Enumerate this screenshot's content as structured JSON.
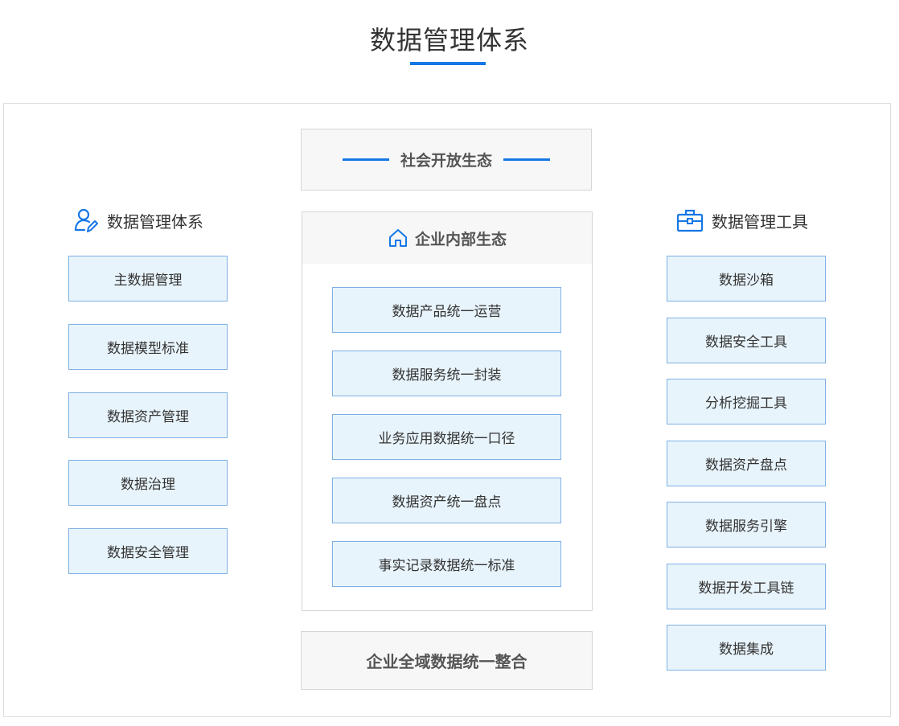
{
  "page_title": "数据管理体系",
  "colors": {
    "accent": "#1677e6",
    "box_fill": "#e8f4fc",
    "box_border": "#7fb0e4",
    "panel_fill": "#f7f7f7"
  },
  "left_column": {
    "title": "数据管理体系",
    "icon": "user-edit-icon",
    "items": [
      "主数据管理",
      "数据模型标准",
      "数据资产管理",
      "数据治理",
      "数据安全管理"
    ]
  },
  "center_column": {
    "top_panel": "社会开放生态",
    "middle_panel": {
      "title": "企业内部生态",
      "icon": "home-icon",
      "items": [
        "数据产品统一运营",
        "数据服务统一封装",
        "业务应用数据统一口径",
        "数据资产统一盘点",
        "事实记录数据统一标准"
      ]
    },
    "bottom_panel": "企业全域数据统一整合"
  },
  "right_column": {
    "title": "数据管理工具",
    "icon": "toolbox-icon",
    "items": [
      "数据沙箱",
      "数据安全工具",
      "分析挖掘工具",
      "数据资产盘点",
      "数据服务引擎",
      "数据开发工具链",
      "数据集成"
    ]
  }
}
